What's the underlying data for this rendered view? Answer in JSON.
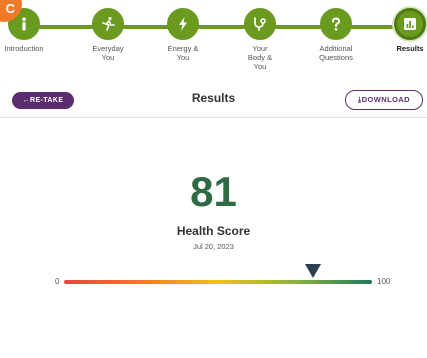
{
  "corner_badge": "C",
  "steps": [
    {
      "label": "Introduction",
      "icon": "info-icon"
    },
    {
      "label": "Everyday You",
      "icon": "running-person-icon"
    },
    {
      "label": "Energy & You",
      "icon": "lightning-icon"
    },
    {
      "label": "Your Body & You",
      "icon": "stethoscope-icon"
    },
    {
      "label": "Additional Questions",
      "icon": "question-icon"
    },
    {
      "label": "Results",
      "icon": "bar-chart-icon",
      "active": true
    }
  ],
  "toolbar": {
    "retake_label": "←RE-TAKE",
    "title": "Results",
    "download_label": "⤓DOWNLOAD"
  },
  "result": {
    "score": "81",
    "label": "Health Score",
    "date": "Jul 20, 2023"
  },
  "gauge": {
    "min": "0",
    "max": "100",
    "value": 81
  },
  "colors": {
    "step_green": "#6a9a1f",
    "brand_purple": "#5c2d6e",
    "score_green": "#2e6b45",
    "badge_orange": "#f07a2a"
  }
}
